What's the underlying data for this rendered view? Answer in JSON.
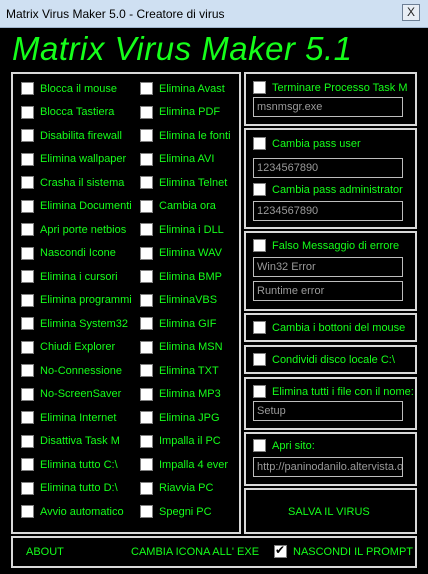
{
  "window": {
    "title": "Matrix Virus Maker 5.0 - Creatore di virus",
    "close_glyph": "X"
  },
  "app_title": "Matrix Virus Maker 5.1",
  "col1": [
    "Blocca il mouse",
    "Blocca Tastiera",
    "Disabilita firewall",
    "Elimina wallpaper",
    "Crasha il sistema",
    "Elimina Documenti",
    "Apri porte netbios",
    "Nascondi Icone",
    "Elimina i cursori",
    "Elimina programmi",
    "Elimina System32",
    "Chiudi Explorer",
    "No-Connessione",
    "No-ScreenSaver",
    "Elimina Internet",
    "Disattiva Task M",
    "Elimina tutto C:\\",
    "Elimina tutto D:\\",
    "Avvio automatico"
  ],
  "col2": [
    "Elimina Avast",
    "Elimina PDF",
    "Elimina le fonti",
    "Elimina AVI",
    "Elimina Telnet",
    "Cambia ora",
    "Elimina i DLL",
    "Elimina WAV",
    "Elimina BMP",
    "EliminaVBS",
    "Elimina GIF",
    "Elimina MSN",
    "Elimina TXT",
    "Elimina MP3",
    "Elimina JPG",
    "Impalla il PC",
    "Impalla 4 ever",
    "Riavvia PC",
    "Spegni PC"
  ],
  "task": {
    "label": "Terminare Processo Task M",
    "value": "msnmsgr.exe"
  },
  "pass": {
    "user_label": "Cambia pass user",
    "user_value": "1234567890",
    "admin_label": "Cambia pass administrator",
    "admin_value": "1234567890"
  },
  "error": {
    "label": "Falso Messaggio di errore",
    "title_value": "Win32 Error",
    "message_value": "Runtime error"
  },
  "mouse_buttons": "Cambia i bottoni del mouse",
  "share_disk": "Condividi disco locale C:\\",
  "delete_files": {
    "label": "Elimina tutti i file con il nome:",
    "value": "Setup"
  },
  "open_site": {
    "label": "Apri sito:",
    "value": "http://paninodanilo.altervista.or"
  },
  "save_button": "SALVA IL VIRUS",
  "bottom": {
    "about": "ABOUT",
    "change_icon": "CAMBIA ICONA ALL' EXE",
    "hide_prompt": "NASCONDI IL PROMPT"
  },
  "colors": {
    "accent": "#15ff1a",
    "background": "#000000",
    "border": "#d9d9d9"
  }
}
